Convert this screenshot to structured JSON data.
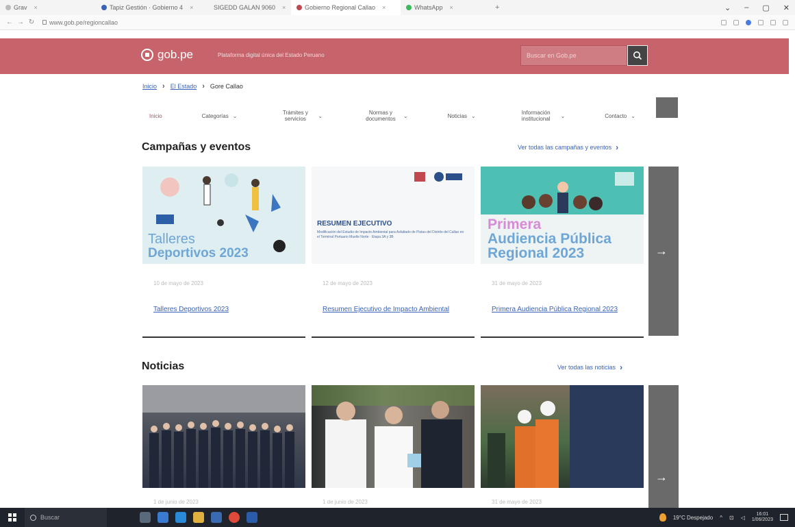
{
  "browser": {
    "tabs": [
      {
        "label": "Grav"
      },
      {
        "label": "Tapiz Gestión · Gobierno 4"
      },
      {
        "label": "SIGEDD GALAN 9060"
      },
      {
        "label": "Gobierno Regional Callao"
      },
      {
        "label": "WhatsApp"
      }
    ],
    "url": "www.gob.pe/regioncallao",
    "window_controls": [
      "⌄",
      "–",
      "▢",
      "✕"
    ]
  },
  "header": {
    "brand": "gob.pe",
    "tagline": "Plataforma digital única del Estado Peruano",
    "search_placeholder": "Buscar en Gob.pe"
  },
  "breadcrumb": {
    "home": "Inicio",
    "state": "El Estado",
    "current": "Gore Callao"
  },
  "menu": [
    {
      "label": "Inicio",
      "active": true
    },
    {
      "label": "Categorías"
    },
    {
      "label": "Trámites y servicios"
    },
    {
      "label": "Normas y documentos"
    },
    {
      "label": "Noticias"
    },
    {
      "label": "Información institucional"
    },
    {
      "label": "Contacto"
    }
  ],
  "campaigns": {
    "title": "Campañas y eventos",
    "see_all": "Ver todas las campañas y eventos",
    "cards": [
      {
        "img_line1": "Talleres",
        "img_line2": "Deportivos 2023",
        "date": "10 de mayo de 2023",
        "title": "Talleres Deportivos 2023"
      },
      {
        "img_heading": "RESUMEN EJECUTIVO",
        "img_body": "Modificación del Estudio de Impacto Ambiental para Asfaltado de Pistas del Distrito del Callao en el Terminal Portuario Muelle Norte · Etapa 3A y 3B",
        "date": "12 de mayo de 2023",
        "title": "Resumen Ejecutivo de Impacto Ambiental"
      },
      {
        "img_line1": "Primera",
        "img_line2": "Audiencia Pública",
        "img_line3": "Regional 2023",
        "date": "31 de mayo de 2023",
        "title": "Primera Audiencia Pública Regional 2023"
      }
    ]
  },
  "news": {
    "title": "Noticias",
    "see_all": "Ver todas las noticias",
    "dates": [
      "1 de junio de 2023",
      "1 de junio de 2023",
      "31 de mayo de 2023"
    ]
  },
  "taskbar": {
    "search_placeholder": "Buscar",
    "weather": "19°C Despejado",
    "time": "16:01",
    "date": "1/06/2023"
  },
  "colors": {
    "header": "#c7646b",
    "link": "#3a63b8"
  }
}
